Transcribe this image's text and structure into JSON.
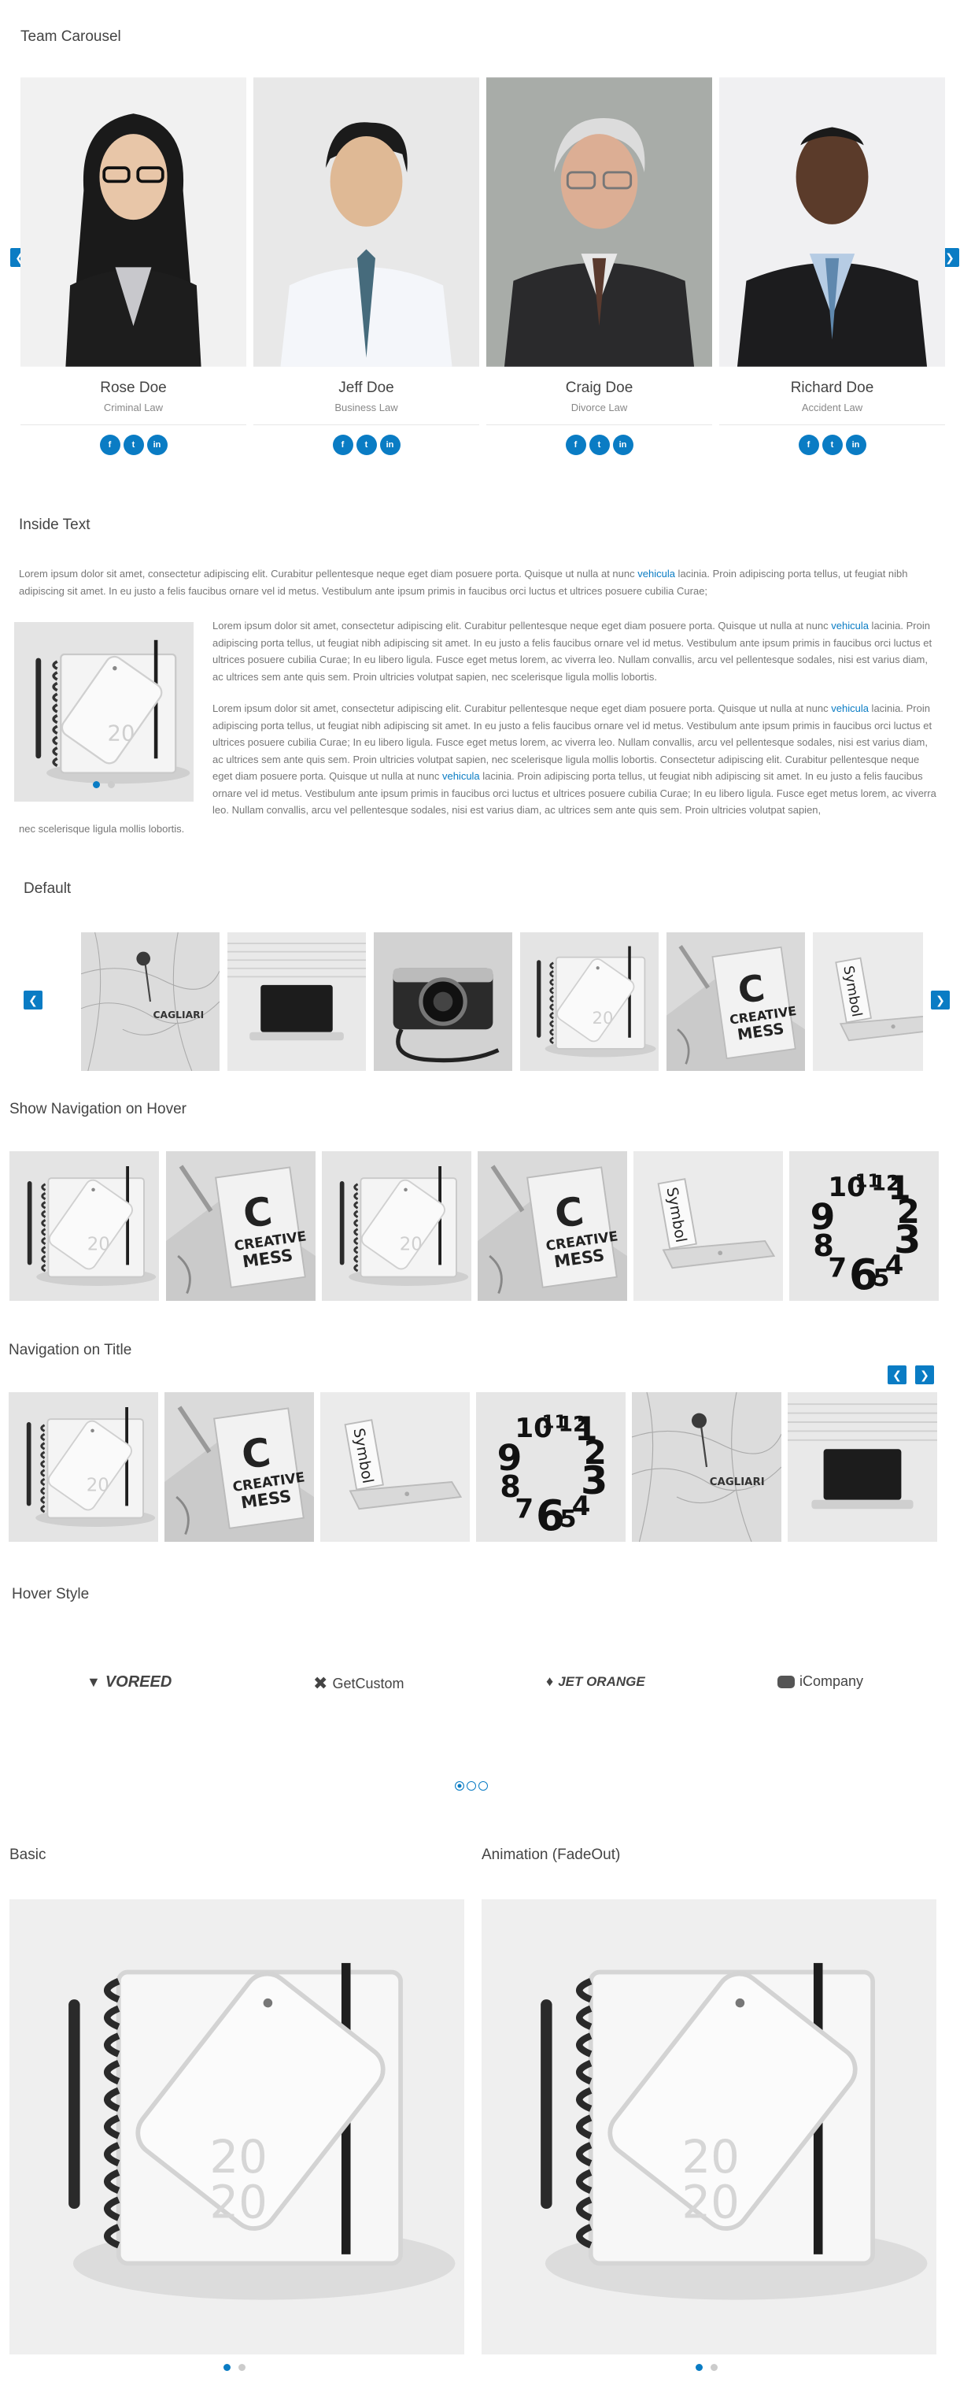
{
  "colors": {
    "accent": "#0a7cc4",
    "text": "#555555",
    "heading": "#444444"
  },
  "team": {
    "title": "Team Carousel",
    "prev_icon": "chevron-left-icon",
    "next_icon": "chevron-right-icon",
    "members": [
      {
        "name": "Rose Doe",
        "role": "Criminal Law"
      },
      {
        "name": "Jeff Doe",
        "role": "Business Law"
      },
      {
        "name": "Craig Doe",
        "role": "Divorce Law"
      },
      {
        "name": "Richard Doe",
        "role": "Accident Law"
      }
    ],
    "social_labels": [
      "f",
      "t",
      "in"
    ]
  },
  "inside": {
    "title": "Inside Text",
    "intro_before": "Lorem ipsum dolor sit amet, consectetur adipiscing elit. Curabitur pellentesque neque eget diam posuere porta. Quisque ut nulla at nunc ",
    "intro_link": "vehicula",
    "intro_after": " lacinia. Proin adipiscing porta tellus, ut feugiat nibh adipiscing sit amet. In eu justo a felis faucibus ornare vel id metus. Vestibulum ante ipsum primis in faucibus orci luctus et ultrices posuere cubilia Curae;",
    "p1_before": "Lorem ipsum dolor sit amet, consectetur adipiscing elit. Curabitur pellentesque neque eget diam posuere porta. Quisque ut nulla at nunc ",
    "p1_link": "vehicula",
    "p1_after": " lacinia. Proin adipiscing porta tellus, ut feugiat nibh adipiscing sit amet. In eu justo a felis faucibus ornare vel id metus. Vestibulum ante ipsum primis in faucibus orci luctus et ultrices posuere cubilia Curae; In eu libero ligula. Fusce eget metus lorem, ac viverra leo. Nullam convallis, arcu vel pellentesque sodales, nisi est varius diam, ac ultrices sem ante quis sem. Proin ultricies volutpat sapien, nec scelerisque ligula mollis lobortis.",
    "p2_a": "Lorem ipsum dolor sit amet, consectetur adipiscing elit. Curabitur pellentesque neque eget diam posuere porta. Quisque ut nulla at nunc ",
    "p2_link1": "vehicula",
    "p2_b": " lacinia. Proin adipiscing porta tellus, ut feugiat nibh adipiscing sit amet. In eu justo a felis faucibus ornare vel id metus. Vestibulum ante ipsum primis in faucibus orci luctus et ultrices posuere cubilia Curae; In eu libero ligula. Fusce eget metus lorem, ac viverra leo. Nullam convallis, arcu vel pellentesque sodales, nisi est varius diam, ac ultrices sem ante quis sem. Proin ultricies volutpat sapien, nec scelerisque ligula mollis lobortis. Consectetur adipiscing elit. Curabitur pellentesque neque eget diam posuere porta. Quisque ut nulla at nunc ",
    "p2_link2": "vehicula",
    "p2_c": " lacinia. Proin adipiscing porta tellus, ut feugiat nibh adipiscing sit amet. In eu justo a felis faucibus ornare vel id metus. Vestibulum ante ipsum primis in faucibus orci luctus et ultrices posuere cubilia Curae; In eu libero ligula. Fusce eget metus lorem, ac viverra leo. Nullam convallis, arcu vel pellentesque sodales, nisi est varius diam, ac ultrices sem ante quis sem. Proin ultricies volutpat sapien,",
    "p2_tail": "nec scelerisque ligula mollis lobortis."
  },
  "default": {
    "title": "Default"
  },
  "hover_nav": {
    "title": "Show Navigation on Hover"
  },
  "title_nav": {
    "title": "Navigation on Title"
  },
  "hover_style": {
    "title": "Hover Style",
    "logos": [
      "VOREED",
      "GetCustom",
      "JET ORANGE",
      "iCompany"
    ]
  },
  "basic": {
    "title": "Basic"
  },
  "fadeout": {
    "title": "Animation (FadeOut)"
  },
  "image_labels": {
    "creative": [
      "C",
      "CREATIVE",
      "MESS"
    ],
    "symbol": "Symbol",
    "clock": [
      "10",
      "11",
      "12",
      "1",
      "2",
      "3",
      "4",
      "5",
      "6",
      "7",
      "8",
      "9"
    ]
  }
}
